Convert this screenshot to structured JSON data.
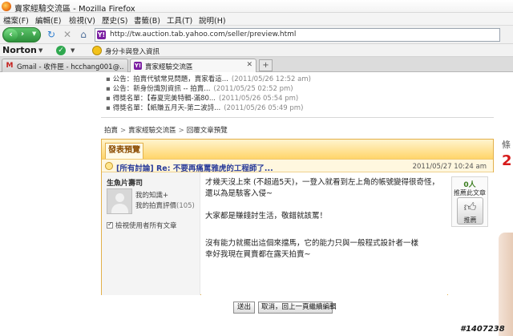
{
  "window": {
    "title": "賣家經驗交流區 - Mozilla Firefox"
  },
  "menu": [
    "檔案(F)",
    "編輯(E)",
    "檢視(V)",
    "歷史(S)",
    "書籤(B)",
    "工具(T)",
    "說明(H)"
  ],
  "nav": {
    "url": "http://tw.auction.tab.yahoo.com/seller/preview.html",
    "site_icon": "Y!"
  },
  "norton": {
    "brand": "Norton",
    "safe_label": "身分卡與登入資訊"
  },
  "tabs": [
    {
      "icon": "M",
      "label": "Gmail - 收件匣 - hcchang001@...",
      "active": false
    },
    {
      "icon": "Y!",
      "label": "賣家經驗交流區",
      "active": true
    }
  ],
  "newtab": "+",
  "notices": [
    {
      "text": "公告：拍賣代號常見問題，賣家看這...",
      "date": "(2011/05/26 12:52 am)"
    },
    {
      "text": "公告：新身份識別資訊 -- 拍賣...",
      "date": "(2011/05/25 02:52 pm)"
    },
    {
      "text": "得獎名單：【春夏完美特輯-滿80...",
      "date": "(2011/05/26 05:54 pm)"
    },
    {
      "text": "得獎名單：【紙賺五月天-第二波詩...",
      "date": "(2011/05/26 05:49 pm)"
    }
  ],
  "breadcrumb": [
    "拍賣",
    "賣家經驗交流區",
    "回覆文章預覽"
  ],
  "breadcrumb_sep": ">",
  "panel": {
    "tab_title": "發表預覽",
    "subject": "[所有討論] Re: 不要再痛罵雅虎的工程師了...",
    "date": "2011/05/27 10:24 am"
  },
  "author": {
    "name": "生魚片壽司",
    "link1": "我的知識+",
    "link2": "我的拍賣評價",
    "rating": "(105)",
    "view_all": "檢視使用者所有文章"
  },
  "content": {
    "p1": "才幾天沒上來 (不超過5天)，一登入就看到左上角的帳號變得很奇怪，還以為是駭客入侵~",
    "p2": "大家都是賺錢討生活，敬錯就該罵！",
    "p3": "沒有能力就擺出這個來擋馬，它的能力只與一般程式設計者一樣",
    "p4": "幸好我現在買賣都在露天拍賣~"
  },
  "vote": {
    "count": "0人",
    "label": "推薦此文章",
    "button": "推薦"
  },
  "buttons": {
    "send": "送出",
    "cancel": "取消，回上一頁繼續編輯"
  },
  "side_ad": {
    "t1": "條",
    "t2": "2"
  },
  "watermark": "#1407238"
}
